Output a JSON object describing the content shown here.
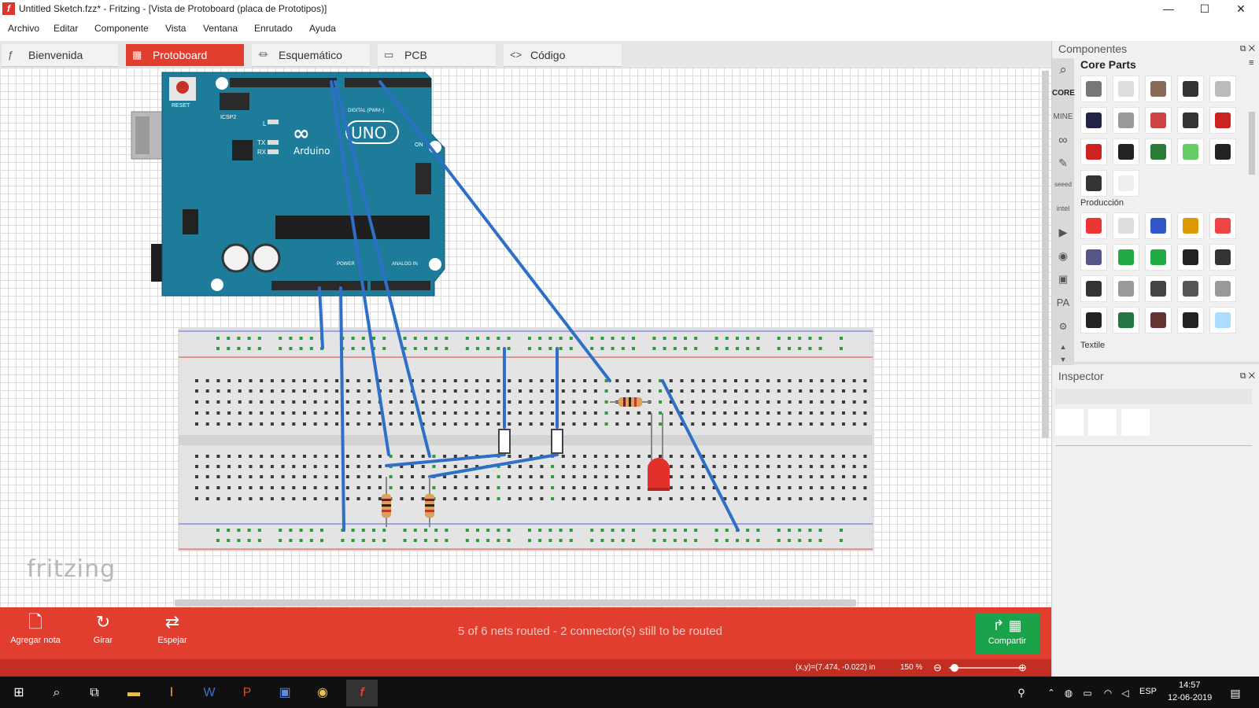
{
  "window": {
    "title": "Untitled Sketch.fzz* - Fritzing - [Vista de Protoboard (placa de Prototipos)]",
    "app_icon": "f",
    "controls": [
      "—",
      "☐",
      "✕"
    ]
  },
  "menu": [
    "Archivo",
    "Editar",
    "Componente",
    "Vista",
    "Ventana",
    "Enrutado",
    "Ayuda"
  ],
  "tabs": [
    {
      "label": "Bienvenida",
      "icon": "fritzing-icon",
      "active": false
    },
    {
      "label": "Protoboard",
      "icon": "breadboard-icon",
      "active": true
    },
    {
      "label": "Esquemático",
      "icon": "schematic-icon",
      "active": false
    },
    {
      "label": "PCB",
      "icon": "pcb-icon",
      "active": false
    },
    {
      "label": "Código",
      "icon": "code-icon",
      "active": false
    }
  ],
  "canvas": {
    "watermark": "fritzing",
    "arduino": {
      "logo": "UNO",
      "brand": "Arduino",
      "reset_label": "RESET",
      "icsp_label": "ICSP2",
      "on_label": "ON",
      "tx_label": "TX",
      "rx_label": "RX",
      "l_label": "L",
      "digital_label": "DIGITAL (PWM~)",
      "power_label": "POWER",
      "analog_label": "ANALOG IN"
    }
  },
  "toolbar": {
    "buttons": [
      {
        "label": "Agregar nota",
        "icon": "note-icon"
      },
      {
        "label": "Girar",
        "icon": "rotate-icon"
      },
      {
        "label": "Espejar",
        "icon": "mirror-icon"
      }
    ],
    "routing_status": "5 of 6 nets routed - 2 connector(s) still to be routed",
    "share_label": "Compartir"
  },
  "statusbar": {
    "coords": "(x,y)=(7.474, -0.022) in",
    "zoom": "150 %"
  },
  "components_panel": {
    "title": "Componentes",
    "bin_title": "Core Parts",
    "bin_tabs": [
      "CORE",
      "MINE",
      "seeed",
      "intel",
      "PA"
    ],
    "section_production": "Producción",
    "section_textile": "Textile"
  },
  "inspector": {
    "title": "Inspector"
  },
  "taskbar": {
    "language": "ESP",
    "time": "14:57",
    "date": "12-06-2019"
  },
  "colors": {
    "accent": "#e13e2f",
    "share": "#1aa34a",
    "wire": "#2e6fc7",
    "arduino": "#1c7c9a"
  }
}
